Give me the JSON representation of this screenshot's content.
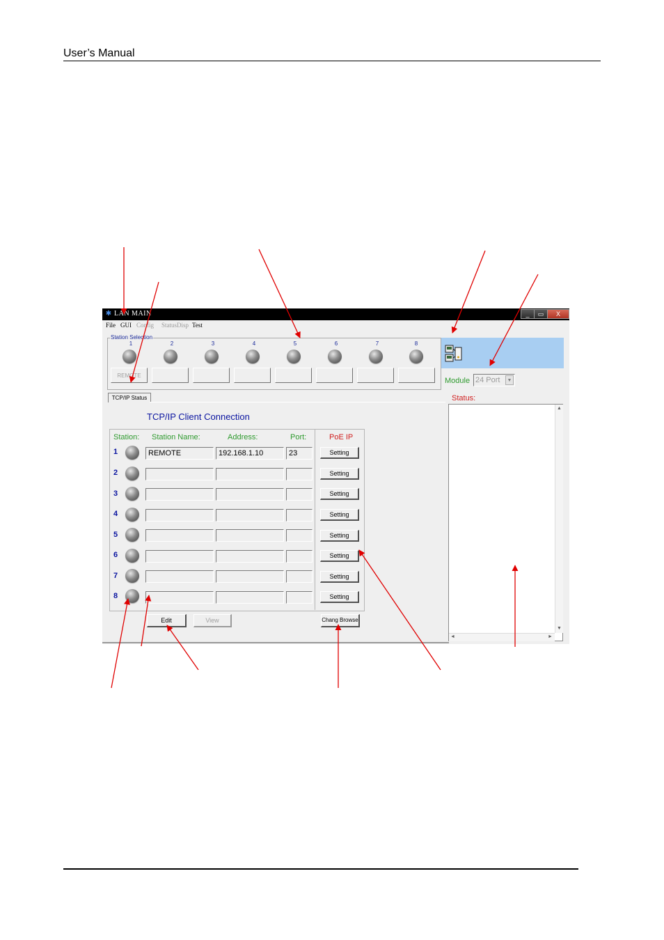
{
  "page": {
    "header_title": "User’s  Manual"
  },
  "window": {
    "title": "LAN MAIN",
    "controls": {
      "minimize": "_",
      "maximize": "▭",
      "close": "X"
    },
    "menu": [
      {
        "label": "File",
        "enabled": true
      },
      {
        "label": "GUI",
        "enabled": true
      },
      {
        "label": "Config",
        "enabled": false
      },
      {
        "label": "StatusDisp",
        "enabled": false
      },
      {
        "label": "Test",
        "enabled": true
      }
    ]
  },
  "station_selection": {
    "label": "Station Selection",
    "stations": [
      "1",
      "2",
      "3",
      "4",
      "5",
      "6",
      "7",
      "8"
    ],
    "buttons": [
      "REMOTE",
      "",
      "",
      "",
      "",
      "",
      "",
      ""
    ]
  },
  "tab": {
    "label": "TCP/IP Status"
  },
  "connection": {
    "title": "TCP/IP Client Connection",
    "headers": {
      "station": "Station:",
      "name": "Station Name:",
      "address": "Address:",
      "port": "Port:",
      "poe": "PoE IP"
    },
    "rows": [
      {
        "num": "1",
        "name": "REMOTE",
        "address": "192.168.1.10",
        "port": "23",
        "button": "Setting"
      },
      {
        "num": "2",
        "name": "",
        "address": "",
        "port": "",
        "button": "Setting"
      },
      {
        "num": "3",
        "name": "",
        "address": "",
        "port": "",
        "button": "Setting"
      },
      {
        "num": "4",
        "name": "",
        "address": "",
        "port": "",
        "button": "Setting"
      },
      {
        "num": "5",
        "name": "",
        "address": "",
        "port": "",
        "button": "Setting"
      },
      {
        "num": "6",
        "name": "",
        "address": "",
        "port": "",
        "button": "Setting"
      },
      {
        "num": "7",
        "name": "",
        "address": "",
        "port": "",
        "button": "Setting"
      },
      {
        "num": "8",
        "name": "",
        "address": "",
        "port": "",
        "button": "Setting"
      }
    ],
    "edit_button": "Edit",
    "view_button": "View",
    "browse_button": "Chang Browse"
  },
  "side": {
    "module_label": "Module",
    "module_value": "24 Port",
    "status_label": "Status:"
  },
  "colors": {
    "accent_blue": "#0a14a0",
    "label_green": "#2e9a2e",
    "label_red": "#d02020",
    "banner": "#a8cef2",
    "annotation_arrow": "#e00000"
  }
}
